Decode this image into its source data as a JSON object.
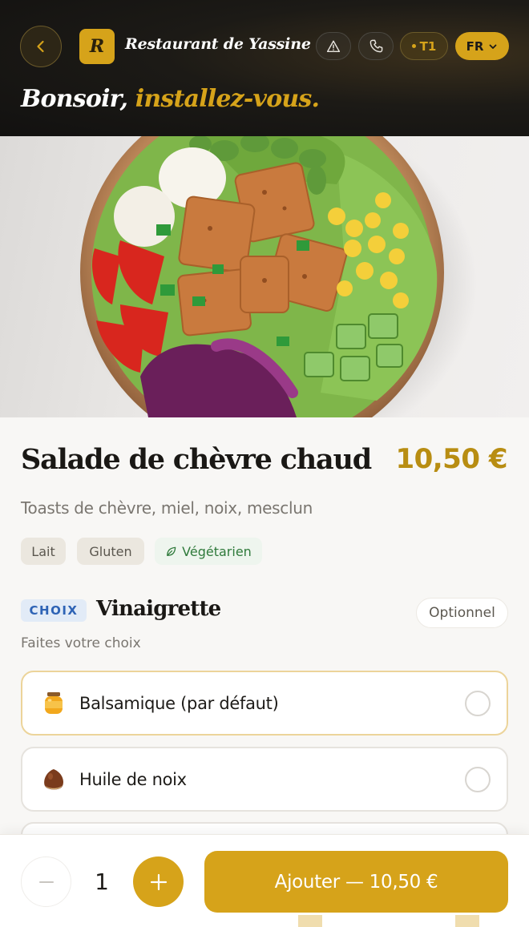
{
  "header": {
    "restaurant_name": "Restaurant de Yassine",
    "logo_letter": "R",
    "table_label": "T1",
    "language": "FR",
    "greeting_plain": "Bonsoir, ",
    "greeting_accent": "installez-vous.",
    "icons": [
      "chevron-left-icon",
      "warning-icon",
      "phone-icon",
      "chevron-down-icon"
    ]
  },
  "dish": {
    "name": "Salade de chèvre chaud",
    "price": "10,50 €",
    "description": "Toasts de chèvre, miel, noix, mesclun",
    "tags": [
      {
        "label": "Lait"
      },
      {
        "label": "Gluten"
      },
      {
        "label": "Végétarien",
        "icon": "leaf-icon"
      }
    ]
  },
  "options_section": {
    "badge": "CHOIX",
    "title": "Vinaigrette",
    "optional_label": "Optionnel",
    "hint": "Faites votre choix",
    "options": [
      {
        "label": "Balsamique (par défaut)",
        "icon": "honey-jar-icon",
        "selected": true
      },
      {
        "label": "Huile de noix",
        "icon": "chestnut-icon",
        "selected": false
      }
    ]
  },
  "order_bar": {
    "quantity": "1",
    "add_label": "Ajouter — 10,50 €"
  },
  "colors": {
    "accent": "#d6a31a",
    "price": "#b88d12",
    "header_bg": "#1c1a16",
    "veg_green": "#2f7a3b",
    "choix_blue": "#2e63b5"
  }
}
